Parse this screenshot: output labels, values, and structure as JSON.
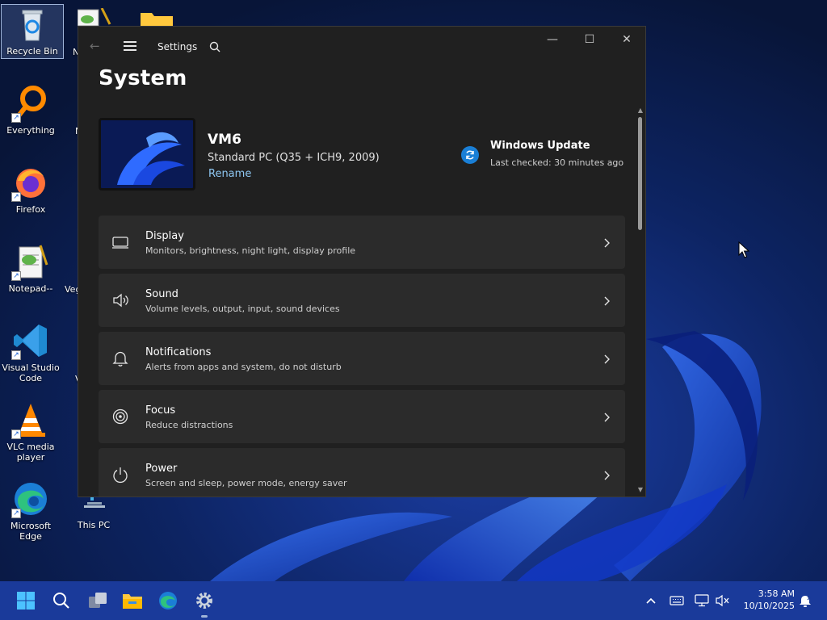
{
  "desktop": {
    "icons": [
      {
        "label": "Recycle Bin",
        "icon": "recycle-bin-icon"
      },
      {
        "label": "Everything",
        "icon": "everything-icon"
      },
      {
        "label": "Firefox",
        "icon": "firefox-icon"
      },
      {
        "label": "Notepad--",
        "icon": "notepad-icon"
      },
      {
        "label": "Visual Studio Code",
        "icon": "vscode-icon"
      },
      {
        "label": "VLC media player",
        "icon": "vlc-icon"
      },
      {
        "label": "Microsoft Edge",
        "icon": "edge-icon"
      },
      {
        "label": "This PC",
        "icon": "this-pc-icon"
      }
    ],
    "partial_labels": {
      "col2_row1": "N",
      "col2_row2": "N",
      "col2_row4": "Veg",
      "col2_row5": "V"
    }
  },
  "window": {
    "app_title": "Settings",
    "page_title": "System",
    "controls": {
      "minimize": "—",
      "maximize": "☐",
      "close": "✕"
    },
    "device": {
      "name": "VM6",
      "model": "Standard PC (Q35 + ICH9, 2009)",
      "rename_label": "Rename"
    },
    "windows_update": {
      "title": "Windows Update",
      "subtitle": "Last checked: 30 minutes ago"
    },
    "items": [
      {
        "title": "Display",
        "desc": "Monitors, brightness, night light, display profile",
        "icon": "display-icon"
      },
      {
        "title": "Sound",
        "desc": "Volume levels, output, input, sound devices",
        "icon": "speaker-icon"
      },
      {
        "title": "Notifications",
        "desc": "Alerts from apps and system, do not disturb",
        "icon": "bell-icon"
      },
      {
        "title": "Focus",
        "desc": "Reduce distractions",
        "icon": "focus-icon"
      },
      {
        "title": "Power",
        "desc": "Screen and sleep, power mode, energy saver",
        "icon": "power-icon"
      }
    ]
  },
  "taskbar": {
    "apps": [
      "start-icon",
      "search-icon",
      "task-view-icon",
      "file-explorer-icon",
      "edge-icon",
      "settings-icon"
    ],
    "tray": [
      "chevron-up-icon",
      "keyboard-icon",
      "network-icon",
      "volume-muted-icon"
    ],
    "clock": {
      "time": "3:58 AM",
      "date": "10/10/2025"
    },
    "notification": "notification-icon"
  },
  "colors": {
    "window_bg": "#202020",
    "card_bg": "#2b2b2b",
    "accent_link": "#8ec7f2",
    "taskbar_bg": "#1a3a9a"
  }
}
